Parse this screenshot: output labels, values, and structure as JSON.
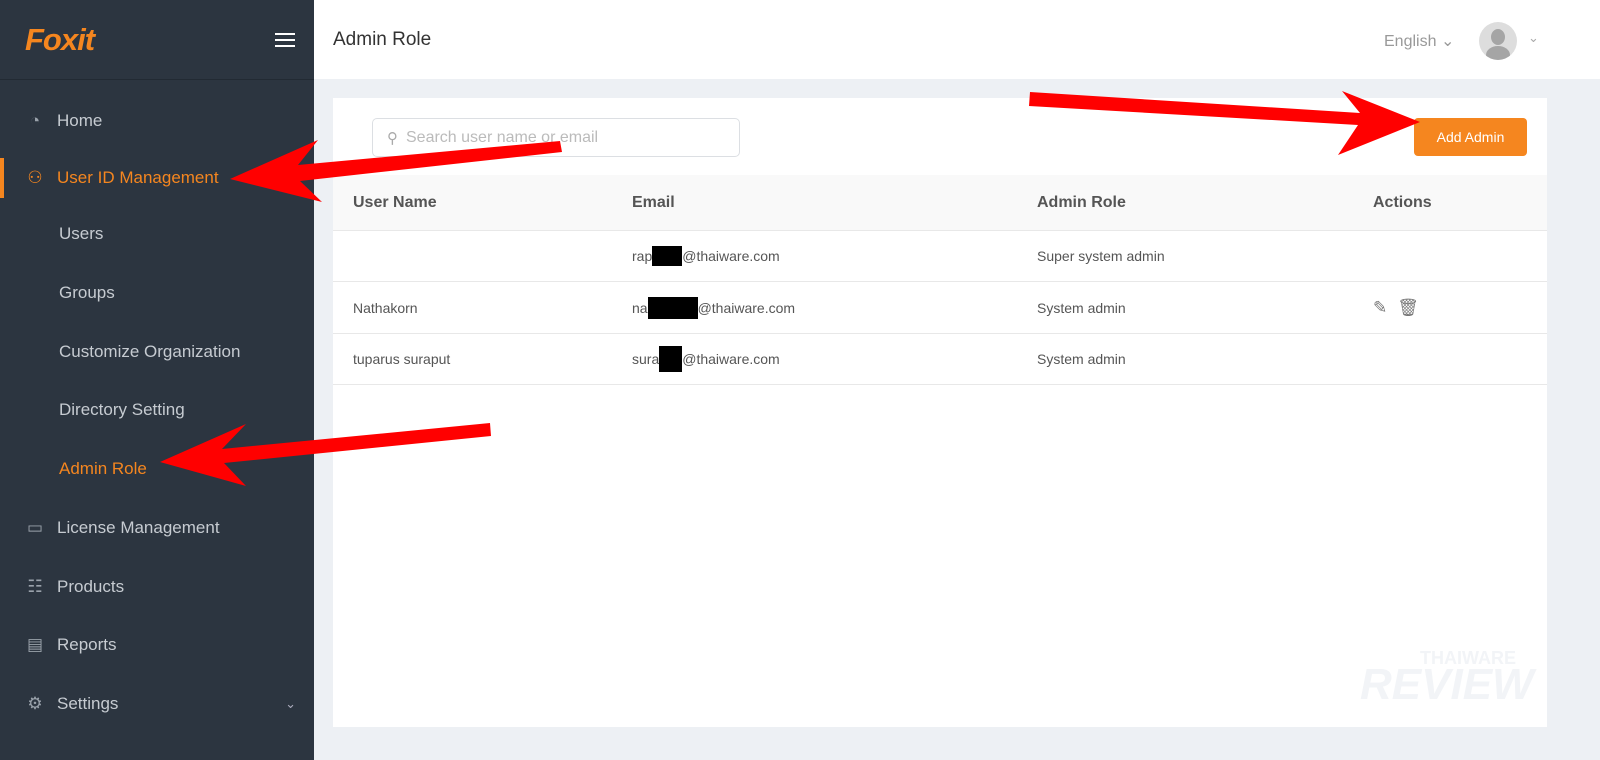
{
  "brand": {
    "logo": "Foxit",
    "accent": "#f5861f"
  },
  "sidebar": {
    "items": [
      {
        "label": "Home",
        "icon": "dashboard-icon"
      },
      {
        "label": "User ID Management",
        "icon": "users-icon"
      },
      {
        "label": "Users"
      },
      {
        "label": "Groups"
      },
      {
        "label": "Customize Organization"
      },
      {
        "label": "Directory Setting"
      },
      {
        "label": "Admin Role"
      },
      {
        "label": "License Management",
        "icon": "cast-icon"
      },
      {
        "label": "Products",
        "icon": "list-icon"
      },
      {
        "label": "Reports",
        "icon": "report-icon"
      },
      {
        "label": "Settings",
        "icon": "gear-icon"
      }
    ]
  },
  "header": {
    "title": "Admin Role",
    "language": "English"
  },
  "main": {
    "search_placeholder": "Search user name or email",
    "add_button": "Add Admin",
    "columns": [
      "User Name",
      "Email",
      "Admin Role",
      "Actions"
    ],
    "rows": [
      {
        "name": "",
        "email_prefix": "rap",
        "email_suffix": "@thaiware.com",
        "role": "Super system admin",
        "actions": false
      },
      {
        "name": "Nathakorn",
        "email_prefix": "na",
        "email_suffix": "@thaiware.com",
        "role": "System admin",
        "actions": true
      },
      {
        "name": "tuparus suraput",
        "email_prefix": "sura",
        "email_suffix": "@thaiware.com",
        "role": "System admin",
        "actions": false
      }
    ]
  },
  "watermark": {
    "top": "THAIWARE",
    "bottom": "REVIEW"
  }
}
